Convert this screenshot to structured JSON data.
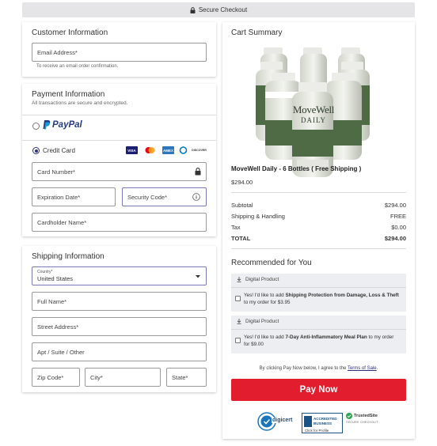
{
  "header": {
    "secure_checkout": "Secure Checkout"
  },
  "customer": {
    "title": "Customer Information",
    "email_placeholder": "Email Address*",
    "email_hint": "To receive an email order confirmation."
  },
  "payment": {
    "title": "Payment Information",
    "subtitle": "All transactions are secure and encrypted.",
    "paypal_label": "PayPal",
    "credit_label": "Credit Card",
    "card_number": "Card Number*",
    "expiration": "Expiration Date*",
    "security_code": "Security Code*",
    "cardholder": "Cardholder Name*",
    "card_brands": [
      "VISA",
      "mastercard",
      "AMEX",
      "Diners",
      "DISCOVER"
    ]
  },
  "shipping": {
    "title": "Shipping Information",
    "country_label": "Country*",
    "country_value": "United States",
    "full_name": "Full Name*",
    "street": "Street Address*",
    "apt": "Apt / Suite / Other",
    "zip": "Zip Code*",
    "city": "City*",
    "state": "State*"
  },
  "cart": {
    "title": "Cart Summary",
    "product_brand": "MoveWell",
    "product_sub": "DAILY",
    "product_name": "MoveWell Daily - 6 Bottles ( Free Shipping )",
    "product_price": "$294.00",
    "subtotal_label": "Subtotal",
    "subtotal_value": "$294.00",
    "shipping_label": "Shipping & Handling",
    "shipping_value": "FREE",
    "tax_label": "Tax",
    "tax_value": "$0.00",
    "total_label": "TOTAL",
    "total_value": "$294.00"
  },
  "recommended": {
    "title": "Recommended for You",
    "items": [
      {
        "tag": "Digital Product",
        "pre": "Yes! I'd like to add ",
        "bold": "Shipping Protection from Damage, Loss & Theft",
        "post": " to my order for $3.95"
      },
      {
        "tag": "Digital Product",
        "pre": "Yes! I'd like to add ",
        "bold": "7-Day Anti-Inflammatory Meal Plan",
        "post": " to my order for $9.00"
      }
    ]
  },
  "terms": {
    "pre": "By clicking Pay Now below, I agree to the ",
    "link": "Terms of Sale",
    "post": "."
  },
  "pay_button": "Pay Now",
  "badges": {
    "digicert": "digicert",
    "bbb_line1": "ACCREDITED",
    "bbb_line2": "BUSINESS",
    "bbb_link": "Click for Profile",
    "trusted": "TrustedSite",
    "trusted_sub": "SECURE CHECKOUT"
  },
  "colors": {
    "accent": "#2e2e7a",
    "pay_button": "#e11d2e",
    "paypal_dark": "#253b80",
    "paypal_light": "#179bd7"
  }
}
